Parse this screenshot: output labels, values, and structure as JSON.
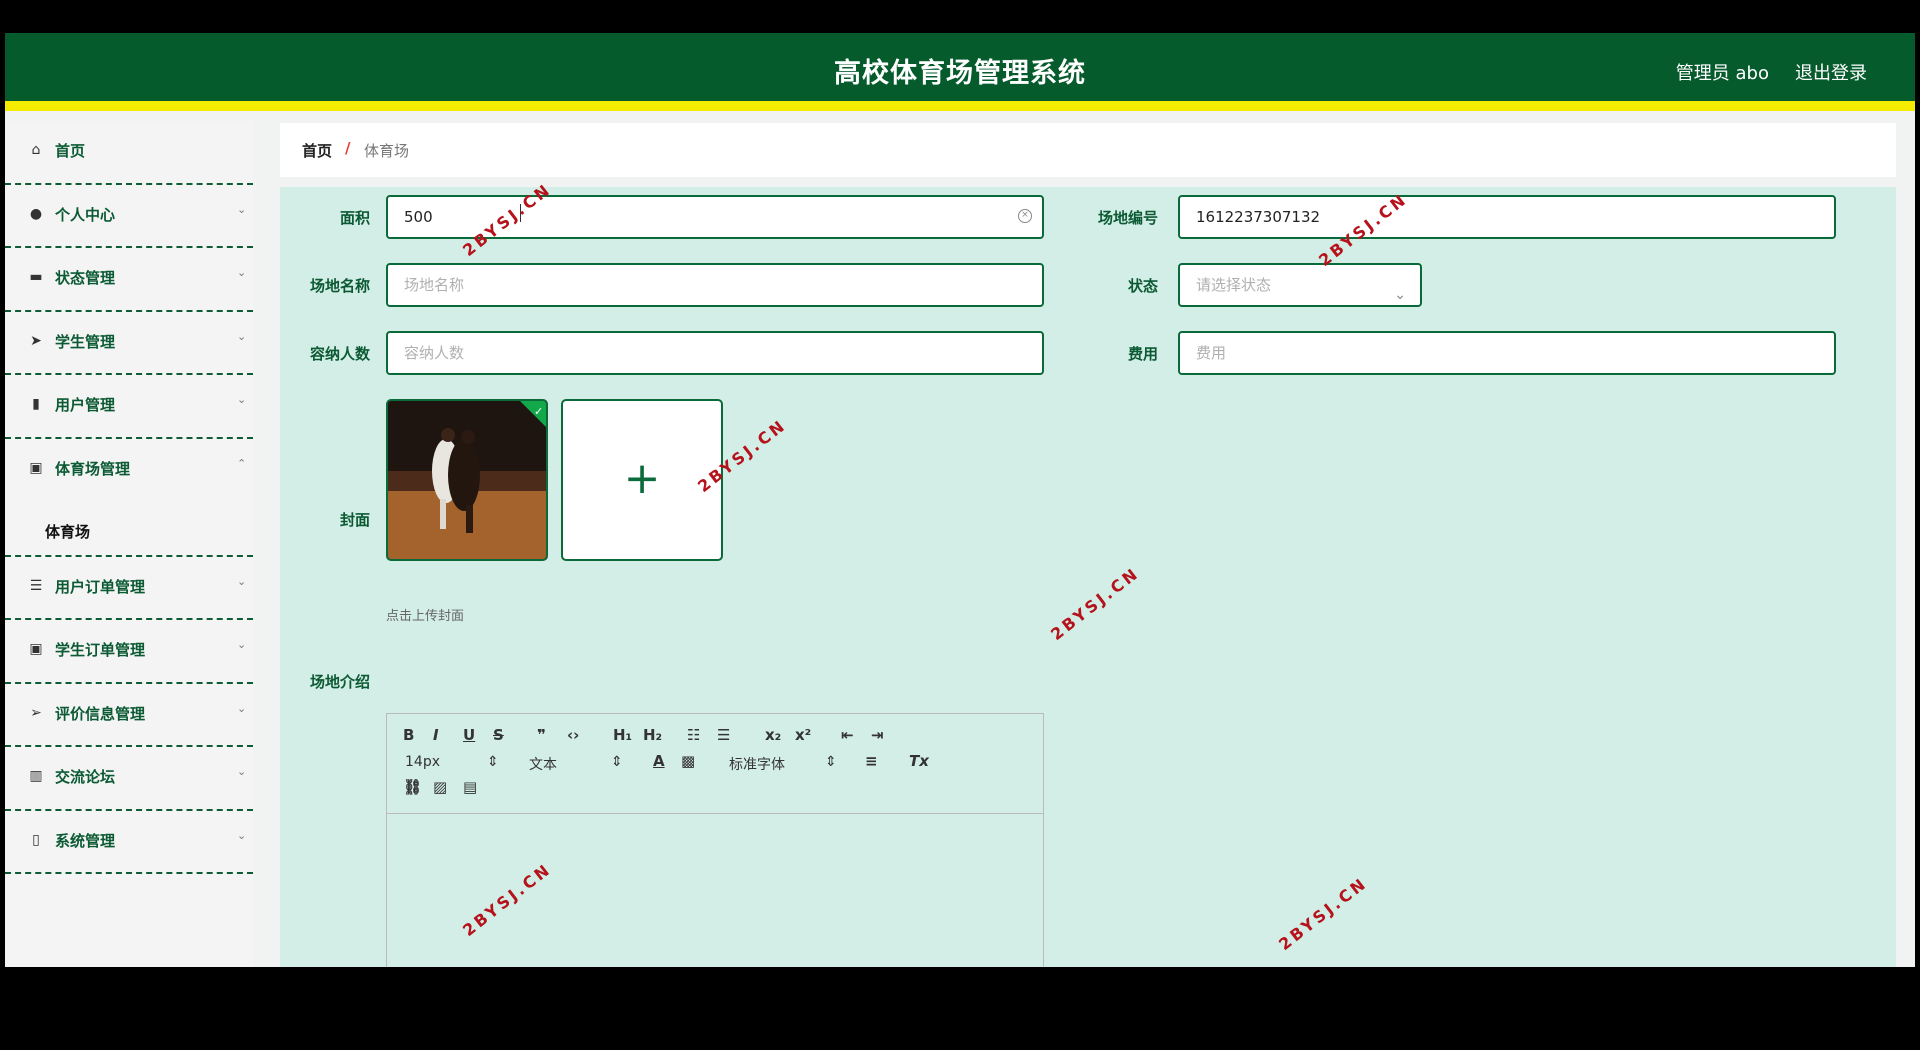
{
  "header": {
    "title": "高校体育场管理系统",
    "user": "管理员 abo",
    "logout": "退出登录"
  },
  "sidebar": {
    "items": [
      {
        "label": "首页",
        "icon": "home-icon"
      },
      {
        "label": "个人中心",
        "icon": "user-icon"
      },
      {
        "label": "状态管理",
        "icon": "briefcase-icon"
      },
      {
        "label": "学生管理",
        "icon": "send-icon"
      },
      {
        "label": "用户管理",
        "icon": "brush-icon"
      },
      {
        "label": "体育场管理",
        "icon": "clipboard-icon",
        "sub": "体育场"
      },
      {
        "label": "用户订单管理",
        "icon": "list-icon"
      },
      {
        "label": "学生订单管理",
        "icon": "clipboard-check-icon"
      },
      {
        "label": "评价信息管理",
        "icon": "navigation-icon"
      },
      {
        "label": "交流论坛",
        "icon": "bar-chart-icon"
      },
      {
        "label": "系统管理",
        "icon": "battery-icon"
      }
    ]
  },
  "breadcrumb": {
    "home": "首页",
    "sep": "/",
    "current": "体育场"
  },
  "form": {
    "area_label": "面积",
    "area_value": "500",
    "code_label": "场地编号",
    "code_value": "1612237307132",
    "name_label": "场地名称",
    "name_placeholder": "场地名称",
    "status_label": "状态",
    "status_placeholder": "请选择状态",
    "capacity_label": "容纳人数",
    "capacity_placeholder": "容纳人数",
    "fee_label": "费用",
    "fee_placeholder": "费用",
    "cover_label": "封面",
    "cover_hint": "点击上传封面",
    "intro_label": "场地介绍",
    "editor": {
      "font_size": "14px",
      "header": "文本",
      "font": "标准字体"
    }
  },
  "watermark": "2BYSJ.CN",
  "colors": {
    "header": "#065b2d",
    "accent": "#f5ec00",
    "form_bg": "#d3eee6"
  }
}
